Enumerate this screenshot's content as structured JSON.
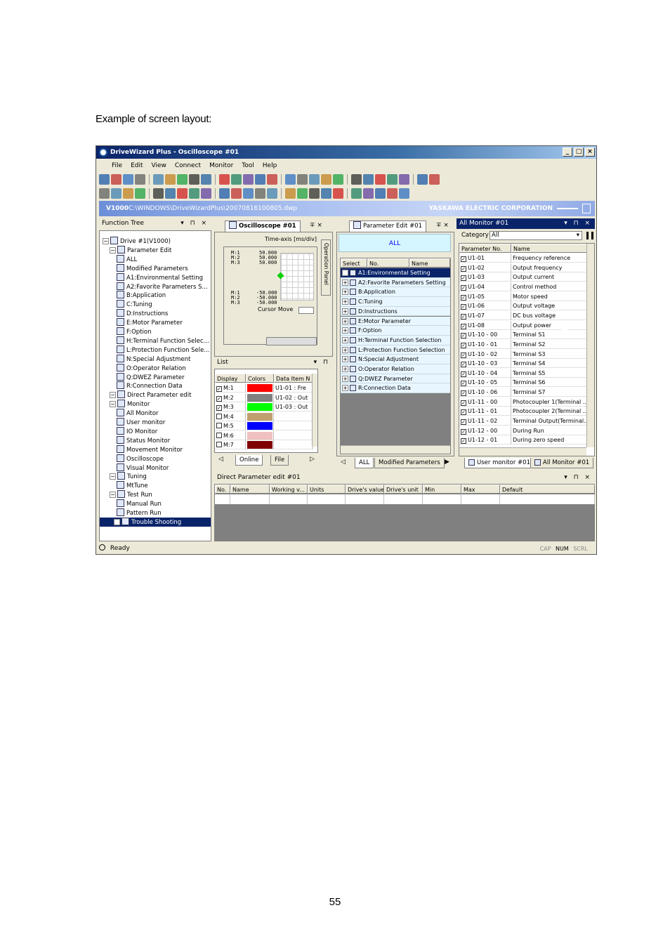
{
  "caption": "Example of screen layout:",
  "page_number": "55",
  "window": {
    "title": "DriveWizard Plus - Oscilloscope #01",
    "buttons": [
      "_",
      "□",
      "×"
    ],
    "menu": [
      "File",
      "Edit",
      "View",
      "Connect",
      "Monitor",
      "Tool",
      "Help"
    ]
  },
  "pathbar": {
    "model": "V1000",
    "path": "C:\\WINDOWS\\DriveWizardPlus\\20070816100805.dwp",
    "corp": "YASKAWA ELECTRIC CORPORATION"
  },
  "function_tree": {
    "title": "Function Tree",
    "ctrls": "▾ ⊓ ×",
    "items": [
      {
        "label": "Drive #1(V1000)",
        "level": 0
      },
      {
        "label": "Parameter Edit",
        "level": 1
      },
      {
        "label": "ALL",
        "level": 2
      },
      {
        "label": "Modified Parameters",
        "level": 2
      },
      {
        "label": "A1:Environmental Setting",
        "level": 2
      },
      {
        "label": "A2:Favorite Parameters S...",
        "level": 2
      },
      {
        "label": "B:Application",
        "level": 2
      },
      {
        "label": "C:Tuning",
        "level": 2
      },
      {
        "label": "D:Instructions",
        "level": 2
      },
      {
        "label": "E:Motor Parameter",
        "level": 2
      },
      {
        "label": "F:Option",
        "level": 2
      },
      {
        "label": "H:Terminal Function Selec...",
        "level": 2
      },
      {
        "label": "L:Protection Function Sele...",
        "level": 2
      },
      {
        "label": "N:Special Adjustment",
        "level": 2
      },
      {
        "label": "O:Operator Relation",
        "level": 2
      },
      {
        "label": "Q:DWEZ Parameter",
        "level": 2
      },
      {
        "label": "R:Connection Data",
        "level": 2
      },
      {
        "label": "Direct Parameter edit",
        "level": 1
      },
      {
        "label": "Monitor",
        "level": 1
      },
      {
        "label": "All Monitor",
        "level": 2
      },
      {
        "label": "User monitor",
        "level": 2
      },
      {
        "label": "IO Monitor",
        "level": 2
      },
      {
        "label": "Status Monitor",
        "level": 2
      },
      {
        "label": "Movement Monitor",
        "level": 2
      },
      {
        "label": "Oscilloscope",
        "level": 2
      },
      {
        "label": "Visual Monitor",
        "level": 2
      },
      {
        "label": "Tuning",
        "level": 1
      },
      {
        "label": "MtTune",
        "level": 2
      },
      {
        "label": "Test Run",
        "level": 1
      },
      {
        "label": "Manual Run",
        "level": 2
      },
      {
        "label": "Pattern Run",
        "level": 2
      },
      {
        "label": "Trouble Shooting",
        "level": 1
      }
    ]
  },
  "oscilloscope": {
    "tab": "Oscilloscope #01",
    "ctrls": "∓ ×",
    "time_axis": "Time-axis [ms/div]",
    "channels_top": [
      "M:1",
      "M:2",
      "M:3"
    ],
    "values_top": [
      "50.000",
      "50.000",
      "50.000"
    ],
    "channels_bottom": [
      "M:1",
      "M:2",
      "M:3"
    ],
    "values_bottom": [
      "-50.000",
      "-50.000",
      "-50.000"
    ],
    "cursor_move": "Cursor Move",
    "side_label": "Operation Panel",
    "list_title": "List",
    "list_ctrls": "▾ ⊓",
    "list_headers": [
      "Display",
      "Colors",
      "Data Item N"
    ],
    "list_rows": [
      {
        "name": "M:1",
        "checked": true,
        "color": "#ff0000",
        "item": "U1-01 : Fre"
      },
      {
        "name": "M:2",
        "checked": true,
        "color": "#808080",
        "item": "U1-02 : Out"
      },
      {
        "name": "M:3",
        "checked": true,
        "color": "#00ff00",
        "item": "U1-03 : Out"
      },
      {
        "name": "M:4",
        "checked": false,
        "color": "#c0a070",
        "item": ""
      },
      {
        "name": "M:5",
        "checked": false,
        "color": "#0000ff",
        "item": ""
      },
      {
        "name": "M:6",
        "checked": false,
        "color": "#f0c0c0",
        "item": ""
      },
      {
        "name": "M:7",
        "checked": false,
        "color": "#800000",
        "item": ""
      }
    ],
    "bottom_tabs": [
      "Online",
      "File"
    ]
  },
  "param_edit": {
    "tab": "Parameter Edit #01",
    "ctrls": "∓ ×",
    "banner": "ALL",
    "headers": [
      "Select",
      "No.",
      "Name"
    ],
    "groups": [
      "A1:Environmental Setting",
      "A2:Favorite Parameters Setting",
      "B:Application",
      "C:Tuning",
      "D:Instructions",
      "E:Motor Parameter",
      "F:Option",
      "H:Terminal Function Selection",
      "L:Protection Function Selection",
      "N:Special Adjustment",
      "O:Operator Relation",
      "Q:DWEZ Parameter",
      "R:Connection Data"
    ],
    "bottom_tabs": [
      "ALL",
      "Modified Parameters"
    ]
  },
  "all_monitor": {
    "title": "All Monitor #01",
    "ctrls": "▾ ⊓ ×",
    "category_label": "Category",
    "category_value": "All",
    "headers": [
      "Parameter No.",
      "Name"
    ],
    "rows": [
      {
        "no": "U1-01",
        "name": "Frequency reference"
      },
      {
        "no": "U1-02",
        "name": "Output frequency"
      },
      {
        "no": "U1-03",
        "name": "Output current"
      },
      {
        "no": "U1-04",
        "name": "Control method"
      },
      {
        "no": "U1-05",
        "name": "Motor speed"
      },
      {
        "no": "U1-06",
        "name": "Output voltage"
      },
      {
        "no": "U1-07",
        "name": "DC bus voltage"
      },
      {
        "no": "U1-08",
        "name": "Output power"
      },
      {
        "no": "U1-10 - 00",
        "name": "Terminal S1"
      },
      {
        "no": "U1-10 - 01",
        "name": "Terminal S2"
      },
      {
        "no": "U1-10 - 02",
        "name": "Terminal S3"
      },
      {
        "no": "U1-10 - 03",
        "name": "Terminal S4"
      },
      {
        "no": "U1-10 - 04",
        "name": "Terminal S5"
      },
      {
        "no": "U1-10 - 05",
        "name": "Terminal S6"
      },
      {
        "no": "U1-10 - 06",
        "name": "Terminal S7"
      },
      {
        "no": "U1-11 - 00",
        "name": "Photocoupler 1(Terminal ..."
      },
      {
        "no": "U1-11 - 01",
        "name": "Photocoupler 2(Terminal ..."
      },
      {
        "no": "U1-11 - 02",
        "name": "Terminal Output(Terminal..."
      },
      {
        "no": "U1-12 - 00",
        "name": "During Run"
      },
      {
        "no": "U1-12 - 01",
        "name": "During zero speed"
      }
    ],
    "bottom_tabs": [
      "User monitor #01",
      "All Monitor #01"
    ]
  },
  "direct_edit": {
    "title": "Direct Parameter edit #01",
    "ctrls": "▾ ⊓ ×",
    "headers": [
      "No.",
      "Name",
      "Working v...",
      "Units",
      "Drive's value",
      "Drive's unit",
      "Min",
      "Max",
      "Default"
    ]
  },
  "status": {
    "text": "Ready",
    "indicators": [
      "CAP",
      "NUM",
      "SCRL"
    ]
  }
}
